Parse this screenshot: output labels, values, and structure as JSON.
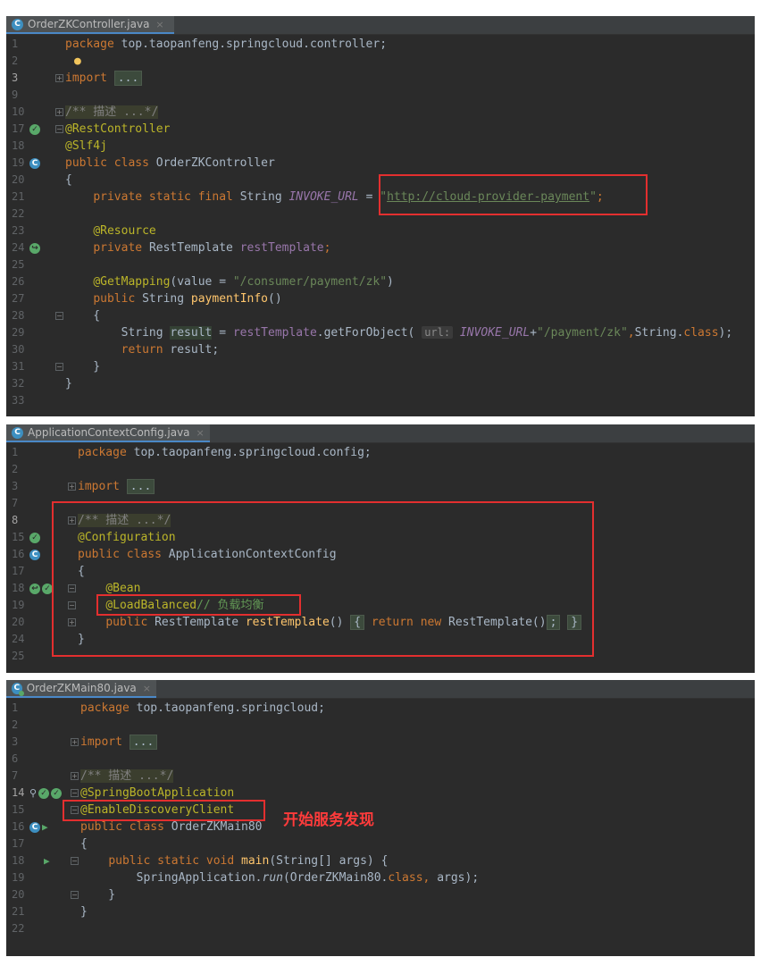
{
  "panel1": {
    "tab": {
      "icon": "class-file-icon",
      "label": "OrderZKController.java",
      "close": "×"
    },
    "lines": [
      {
        "n": "1",
        "tokens": [
          [
            "kw",
            "package "
          ],
          [
            "",
            "top.taopanfeng.springcloud.controller;"
          ]
        ]
      },
      {
        "n": "2",
        "tokens": [],
        "gutter": "bulb"
      },
      {
        "n": "3",
        "tokens": [
          [
            "kw",
            "import "
          ],
          [
            "fbox",
            "..."
          ]
        ],
        "fold": "plus",
        "current": true
      },
      {
        "n": "9",
        "tokens": []
      },
      {
        "n": "10",
        "tokens": [
          [
            "cmf",
            "/** 描述 ...*/"
          ]
        ],
        "fold": "plus"
      },
      {
        "n": "17",
        "tokens": [
          [
            "an",
            "@RestController"
          ]
        ],
        "fold": "minus",
        "gutter": "bean-check"
      },
      {
        "n": "18",
        "tokens": [
          [
            "an",
            "@Slf4j"
          ]
        ]
      },
      {
        "n": "19",
        "tokens": [
          [
            "kw",
            "public class "
          ],
          [
            "",
            "OrderZKController"
          ]
        ],
        "gutter": "bean-class"
      },
      {
        "n": "20",
        "tokens": [
          [
            "",
            "{"
          ]
        ]
      },
      {
        "n": "21",
        "tokens": [
          [
            "",
            "    "
          ],
          [
            "kw",
            "private static final "
          ],
          [
            "",
            "String "
          ],
          [
            "fldi",
            "INVOKE_URL"
          ],
          [
            "",
            " = "
          ],
          [
            "str",
            "\""
          ],
          [
            "url",
            "http://cloud-provider-payment"
          ],
          [
            "str",
            "\""
          ],
          [
            "kw",
            ";"
          ]
        ]
      },
      {
        "n": "22",
        "tokens": []
      },
      {
        "n": "23",
        "tokens": [
          [
            "",
            "    "
          ],
          [
            "an",
            "@Resource"
          ]
        ]
      },
      {
        "n": "24",
        "tokens": [
          [
            "",
            "    "
          ],
          [
            "kw",
            "private "
          ],
          [
            "",
            "RestTemplate "
          ],
          [
            "fld",
            "restTemplate"
          ],
          [
            "kw",
            ";"
          ]
        ],
        "gutter": "bean-autowire"
      },
      {
        "n": "25",
        "tokens": []
      },
      {
        "n": "26",
        "tokens": [
          [
            "",
            "    "
          ],
          [
            "an",
            "@GetMapping"
          ],
          [
            "",
            "(value = "
          ],
          [
            "str",
            "\"/consumer/payment/zk\""
          ],
          [
            "",
            ")"
          ]
        ]
      },
      {
        "n": "27",
        "tokens": [
          [
            "",
            "    "
          ],
          [
            "kw",
            "public "
          ],
          [
            "",
            "String "
          ],
          [
            "fn",
            "paymentInfo"
          ],
          [
            "",
            "()"
          ]
        ]
      },
      {
        "n": "28",
        "tokens": [
          [
            "",
            "    {"
          ]
        ],
        "fold": "minus"
      },
      {
        "n": "29",
        "tokens": [
          [
            "",
            "        String "
          ],
          [
            "hl",
            "result"
          ],
          [
            "",
            " = "
          ],
          [
            "fld",
            "restTemplate"
          ],
          [
            "",
            ".getForObject( "
          ],
          [
            "hint",
            "url:"
          ],
          [
            "",
            " "
          ],
          [
            "fldi",
            "INVOKE_URL"
          ],
          [
            "",
            "+"
          ],
          [
            "str",
            "\"/payment/zk\""
          ],
          [
            "kw",
            ","
          ],
          [
            "",
            "String."
          ],
          [
            "kw",
            "class"
          ],
          [
            "",
            ");"
          ]
        ]
      },
      {
        "n": "30",
        "tokens": [
          [
            "",
            "        "
          ],
          [
            "kw",
            "return "
          ],
          [
            "",
            "result;"
          ]
        ]
      },
      {
        "n": "31",
        "tokens": [
          [
            "",
            "    }"
          ]
        ],
        "fold": "minus"
      },
      {
        "n": "32",
        "tokens": [
          [
            "",
            "}"
          ]
        ]
      },
      {
        "n": "33",
        "tokens": []
      }
    ]
  },
  "panel2": {
    "tab": {
      "icon": "class-file-icon",
      "label": "ApplicationContextConfig.java",
      "close": "×"
    },
    "lines": [
      {
        "n": "1",
        "tokens": [
          [
            "kw",
            "package "
          ],
          [
            "",
            "top.taopanfeng.springcloud.config;"
          ]
        ]
      },
      {
        "n": "2",
        "tokens": []
      },
      {
        "n": "3",
        "tokens": [
          [
            "kw",
            "import "
          ],
          [
            "fbox",
            "..."
          ]
        ],
        "fold": "plus"
      },
      {
        "n": "7",
        "tokens": []
      },
      {
        "n": "8",
        "tokens": [
          [
            "cmf",
            "/** 描述 ...*/"
          ]
        ],
        "fold": "plus",
        "current": true
      },
      {
        "n": "15",
        "tokens": [
          [
            "an",
            "@Configuration"
          ]
        ],
        "gutter": "bean-check"
      },
      {
        "n": "16",
        "tokens": [
          [
            "kw",
            "public class "
          ],
          [
            "",
            "ApplicationContextConfig"
          ]
        ],
        "gutter": "bean-class"
      },
      {
        "n": "17",
        "tokens": [
          [
            "",
            "{"
          ]
        ]
      },
      {
        "n": "18",
        "tokens": [
          [
            "",
            "    "
          ],
          [
            "an",
            "@Bean"
          ]
        ],
        "fold": "minus",
        "gutter": "bean-double"
      },
      {
        "n": "19",
        "tokens": [
          [
            "",
            "    "
          ],
          [
            "an",
            "@LoadBalanced"
          ],
          [
            "cm",
            "// 负载均衡"
          ]
        ],
        "fold": "minus"
      },
      {
        "n": "20",
        "tokens": [
          [
            "",
            "    "
          ],
          [
            "kw",
            "public "
          ],
          [
            "",
            "RestTemplate "
          ],
          [
            "fn",
            "restTemplate"
          ],
          [
            "",
            "() "
          ],
          [
            "fbox",
            "{"
          ],
          [
            "",
            " "
          ],
          [
            "kw",
            "return new "
          ],
          [
            "",
            "RestTemplate()"
          ],
          [
            "fbox",
            ";"
          ],
          [
            "",
            " "
          ],
          [
            "fbox",
            "}"
          ]
        ],
        "fold": "plus"
      },
      {
        "n": "24",
        "tokens": [
          [
            "",
            "}"
          ]
        ]
      },
      {
        "n": "25",
        "tokens": []
      }
    ]
  },
  "panel3": {
    "tab": {
      "icon": "boot-class-file-icon",
      "label": "OrderZKMain80.java",
      "close": "×"
    },
    "lines": [
      {
        "n": "1",
        "tokens": [
          [
            "kw",
            "package "
          ],
          [
            "",
            "top.taopanfeng.springcloud;"
          ]
        ]
      },
      {
        "n": "2",
        "tokens": []
      },
      {
        "n": "3",
        "tokens": [
          [
            "kw",
            "import "
          ],
          [
            "fbox",
            "..."
          ]
        ],
        "fold": "plus"
      },
      {
        "n": "6",
        "tokens": []
      },
      {
        "n": "7",
        "tokens": [
          [
            "cmf",
            "/** 描述 ...*/"
          ]
        ],
        "fold": "plus"
      },
      {
        "n": "14",
        "tokens": [
          [
            "an",
            "@SpringBootApplication"
          ]
        ],
        "fold": "minus",
        "gutter": "boot-search",
        "current": true
      },
      {
        "n": "15",
        "tokens": [
          [
            "an",
            "@EnableDiscoveryClient"
          ]
        ],
        "fold": "minus"
      },
      {
        "n": "16",
        "tokens": [
          [
            "kw",
            "public class "
          ],
          [
            "",
            "OrderZKMain80"
          ]
        ],
        "gutter": "class-run"
      },
      {
        "n": "17",
        "tokens": [
          [
            "",
            "{"
          ]
        ]
      },
      {
        "n": "18",
        "tokens": [
          [
            "",
            "    "
          ],
          [
            "kw",
            "public static void "
          ],
          [
            "fn",
            "main"
          ],
          [
            "",
            "(String[] args) {"
          ]
        ],
        "fold": "minus",
        "gutter": "run"
      },
      {
        "n": "19",
        "tokens": [
          [
            "",
            "        SpringApplication."
          ],
          [
            "it",
            "run"
          ],
          [
            "",
            "(OrderZKMain80."
          ],
          [
            "kw",
            "class"
          ],
          [
            "kw",
            ", "
          ],
          [
            "",
            "args);"
          ]
        ]
      },
      {
        "n": "20",
        "tokens": [
          [
            "",
            "    }"
          ]
        ],
        "fold": "minus"
      },
      {
        "n": "21",
        "tokens": [
          [
            "",
            "}"
          ]
        ]
      },
      {
        "n": "22",
        "tokens": []
      }
    ],
    "caption": "开始服务发现"
  }
}
